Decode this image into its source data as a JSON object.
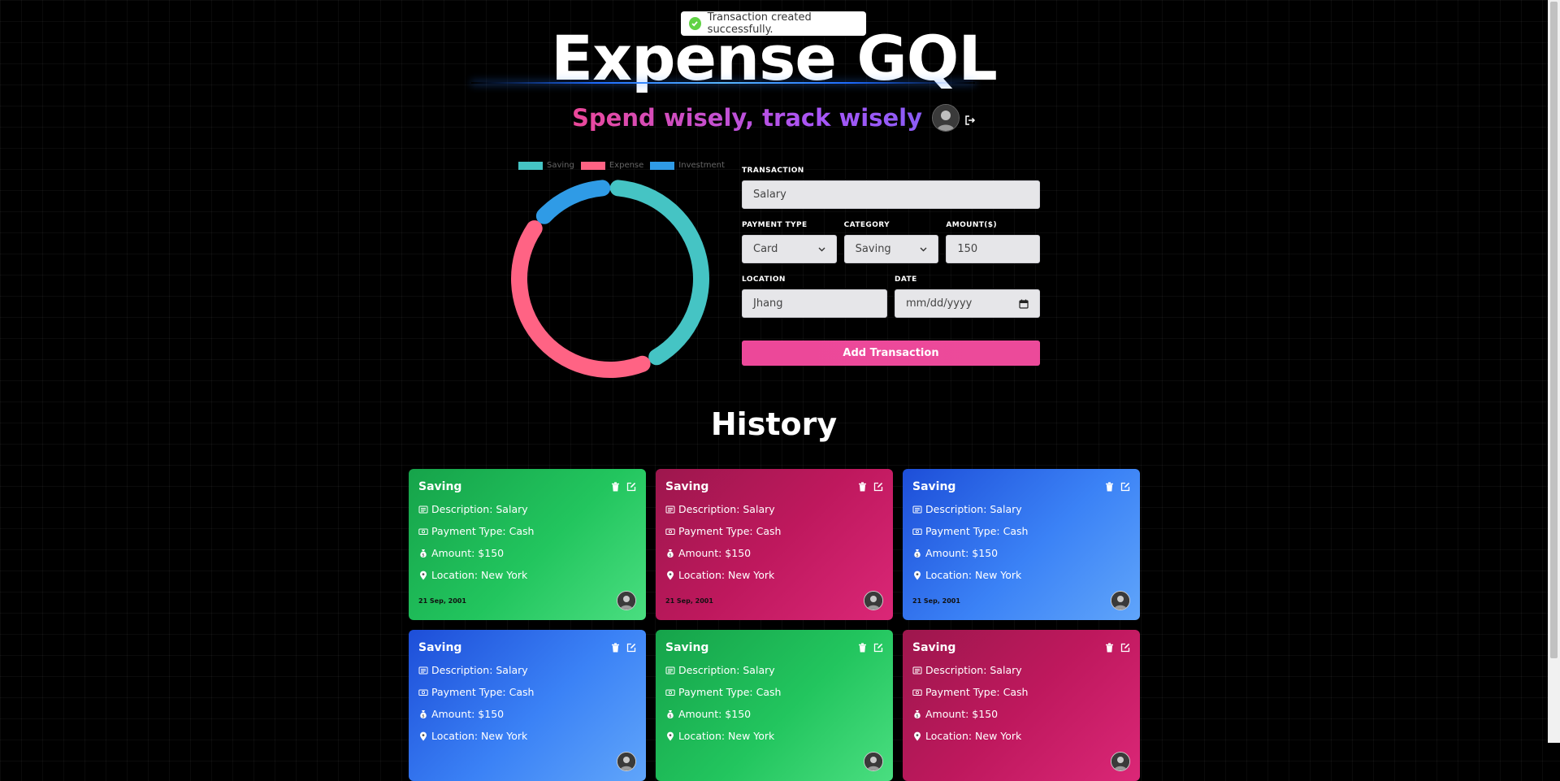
{
  "toast": {
    "message": "Transaction created successfully."
  },
  "header": {
    "title": "Expense GQL",
    "subtitle": "Spend wisely, track wisely"
  },
  "chart_data": {
    "type": "doughnut",
    "legend": [
      "Saving",
      "Expense",
      "Investment"
    ],
    "colors": [
      "#45c4c4",
      "#ff6384",
      "#2f9be6"
    ],
    "values": [
      150,
      150,
      50
    ],
    "legend_position": "top"
  },
  "form": {
    "transaction_label": "TRANSACTION",
    "transaction_value": "Salary",
    "payment_type_label": "PAYMENT TYPE",
    "payment_type_value": "Card",
    "category_label": "CATEGORY",
    "category_value": "Saving",
    "amount_label": "AMOUNT($)",
    "amount_value": "150",
    "location_label": "LOCATION",
    "location_value": "Jhang",
    "date_label": "DATE",
    "date_placeholder": "mm/dd/yyyy",
    "submit_label": "Add Transaction"
  },
  "history": {
    "title": "History",
    "cards": [
      {
        "category": "Saving",
        "description": "Description: Salary",
        "payment": "Payment Type: Cash",
        "amount": "Amount: $150",
        "location": "Location: New York",
        "date": "21 Sep, 2001",
        "color": "green"
      },
      {
        "category": "Saving",
        "description": "Description: Salary",
        "payment": "Payment Type: Cash",
        "amount": "Amount: $150",
        "location": "Location: New York",
        "date": "21 Sep, 2001",
        "color": "pink"
      },
      {
        "category": "Saving",
        "description": "Description: Salary",
        "payment": "Payment Type: Cash",
        "amount": "Amount: $150",
        "location": "Location: New York",
        "date": "21 Sep, 2001",
        "color": "blue"
      },
      {
        "category": "Saving",
        "description": "Description: Salary",
        "payment": "Payment Type: Cash",
        "amount": "Amount: $150",
        "location": "Location: New York",
        "date": "",
        "color": "blue"
      },
      {
        "category": "Saving",
        "description": "Description: Salary",
        "payment": "Payment Type: Cash",
        "amount": "Amount: $150",
        "location": "Location: New York",
        "date": "",
        "color": "green"
      },
      {
        "category": "Saving",
        "description": "Description: Salary",
        "payment": "Payment Type: Cash",
        "amount": "Amount: $150",
        "location": "Location: New York",
        "date": "",
        "color": "pink"
      }
    ]
  }
}
